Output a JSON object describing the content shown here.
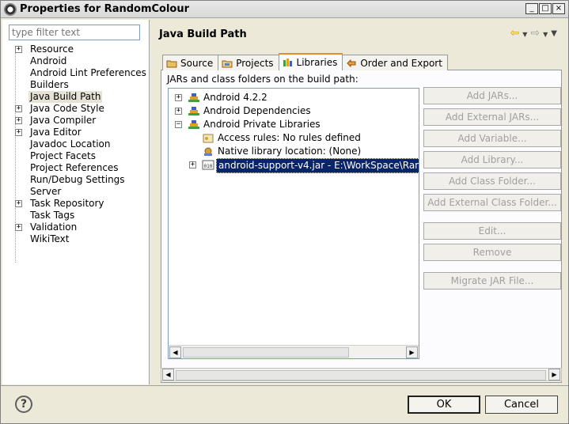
{
  "window": {
    "title": "Properties for RandomColour",
    "minimize_glyph": "_",
    "maximize_glyph": "□",
    "close_glyph": "×"
  },
  "left": {
    "filter_placeholder": "type filter text",
    "tree": [
      {
        "label": "Resource",
        "expandable": true
      },
      {
        "label": "Android",
        "expandable": false
      },
      {
        "label": "Android Lint Preferences",
        "expandable": false
      },
      {
        "label": "Builders",
        "expandable": false
      },
      {
        "label": "Java Build Path",
        "expandable": false,
        "selected": true
      },
      {
        "label": "Java Code Style",
        "expandable": true
      },
      {
        "label": "Java Compiler",
        "expandable": true
      },
      {
        "label": "Java Editor",
        "expandable": true
      },
      {
        "label": "Javadoc Location",
        "expandable": false
      },
      {
        "label": "Project Facets",
        "expandable": false
      },
      {
        "label": "Project References",
        "expandable": false
      },
      {
        "label": "Run/Debug Settings",
        "expandable": false
      },
      {
        "label": "Server",
        "expandable": false
      },
      {
        "label": "Task Repository",
        "expandable": true
      },
      {
        "label": "Task Tags",
        "expandable": false
      },
      {
        "label": "Validation",
        "expandable": true
      },
      {
        "label": "WikiText",
        "expandable": false
      }
    ]
  },
  "right": {
    "title": "Java Build Path",
    "tabs": [
      "Source",
      "Projects",
      "Libraries",
      "Order and Export"
    ],
    "active_tab": "Libraries",
    "caption": "JARs and class folders on the build path:",
    "libs": [
      {
        "label": "Android 4.2.2",
        "expanded": false
      },
      {
        "label": "Android Dependencies",
        "expanded": false
      },
      {
        "label": "Android Private Libraries",
        "expanded": true
      },
      {
        "label": "Access rules: No rules defined"
      },
      {
        "label": "Native library location: (None)"
      },
      {
        "label": "android-support-v4.jar - E:\\WorkSpace\\Ran",
        "selected": true
      }
    ],
    "buttons": {
      "add_jars": "Add JARs...",
      "add_external_jars": "Add External JARs...",
      "add_variable": "Add Variable...",
      "add_library": "Add Library...",
      "add_class_folder": "Add Class Folder...",
      "add_external_class_folder": "Add External Class Folder...",
      "edit": "Edit...",
      "remove": "Remove",
      "migrate_jar": "Migrate JAR File..."
    }
  },
  "footer": {
    "help": "?",
    "ok": "OK",
    "cancel": "Cancel"
  },
  "colors": {
    "selection": "#0a246a",
    "tab_accent": "#e68b2c",
    "disabled_text": "#a0a0a0"
  }
}
